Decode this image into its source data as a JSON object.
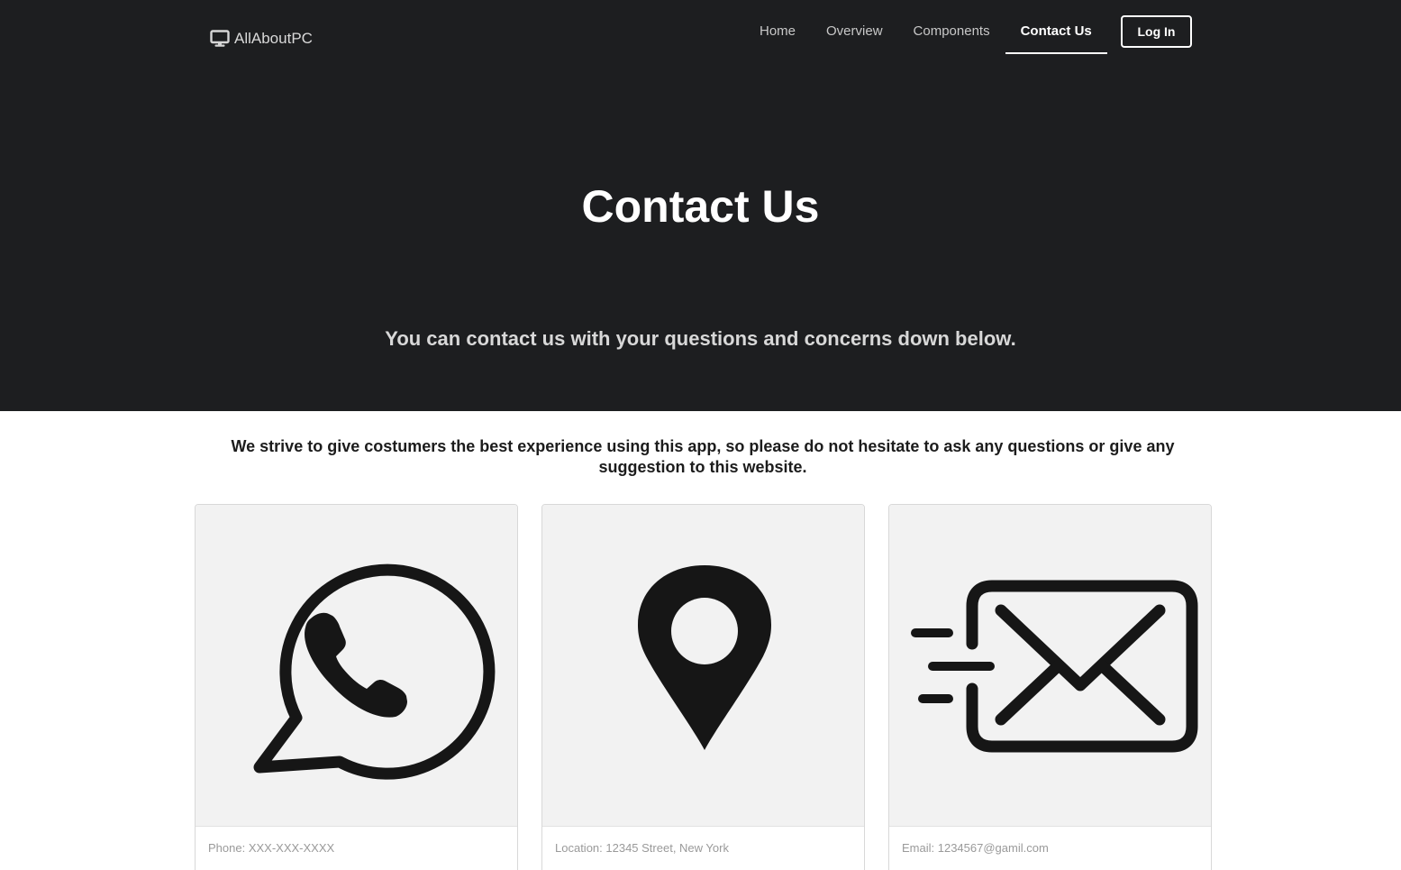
{
  "brand": {
    "name": "AllAboutPC",
    "icon": "monitor-icon"
  },
  "nav": {
    "items": [
      {
        "label": "Home",
        "active": false
      },
      {
        "label": "Overview",
        "active": false
      },
      {
        "label": "Components",
        "active": false
      },
      {
        "label": "Contact Us",
        "active": true
      }
    ],
    "login_label": "Log In"
  },
  "hero": {
    "title": "Contact Us",
    "subtitle": "You can contact us with your questions and concerns down below."
  },
  "intro": "We strive to give costumers the best experience using this app, so please do not hesitate to ask any questions or give any suggestion to this website.",
  "cards": [
    {
      "icon": "whatsapp-phone-icon",
      "caption": "Phone: XXX-XXX-XXXX"
    },
    {
      "icon": "location-pin-icon",
      "caption": "Location: 12345 Street, New York"
    },
    {
      "icon": "email-envelope-icon",
      "caption": "Email: 1234567@gamil.com"
    }
  ],
  "colors": {
    "hero_bg": "#1d1e20",
    "card_art_bg": "#f2f2f2",
    "icon": "#111111",
    "caption": "#9a9a9a"
  }
}
